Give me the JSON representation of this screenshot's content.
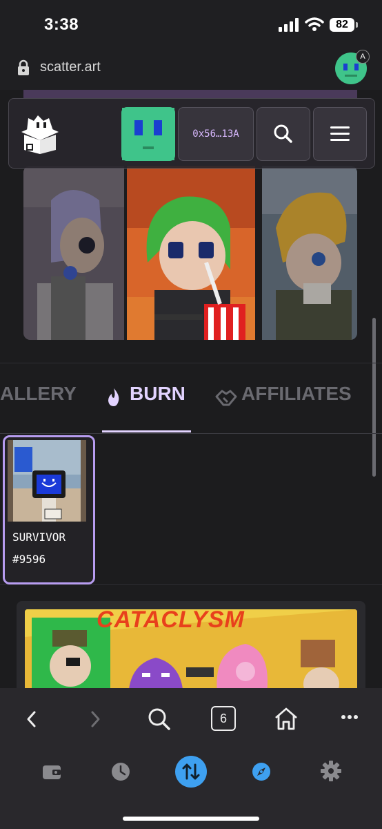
{
  "status_bar": {
    "time": "3:38",
    "battery": "82"
  },
  "browser": {
    "url": "scatter.art",
    "avatar_badge": "A",
    "tab_count": "6"
  },
  "site_nav": {
    "wallet_address": "0x56…13A"
  },
  "tabs": [
    {
      "label": "ALLERY",
      "active": false
    },
    {
      "label": "BURN",
      "active": true
    },
    {
      "label": "AFFILIATES",
      "active": false
    }
  ],
  "nft": {
    "name": "SURVIVOR",
    "number": "#9596"
  },
  "banner": {
    "title": "CATACLYSM"
  },
  "colors": {
    "accent": "#b79cf0",
    "active_tab": "#e2d3ff",
    "wallet_text": "#d9b9ff",
    "banner_title": "#e8401c",
    "toolbar_blue": "#3ea0f0"
  }
}
